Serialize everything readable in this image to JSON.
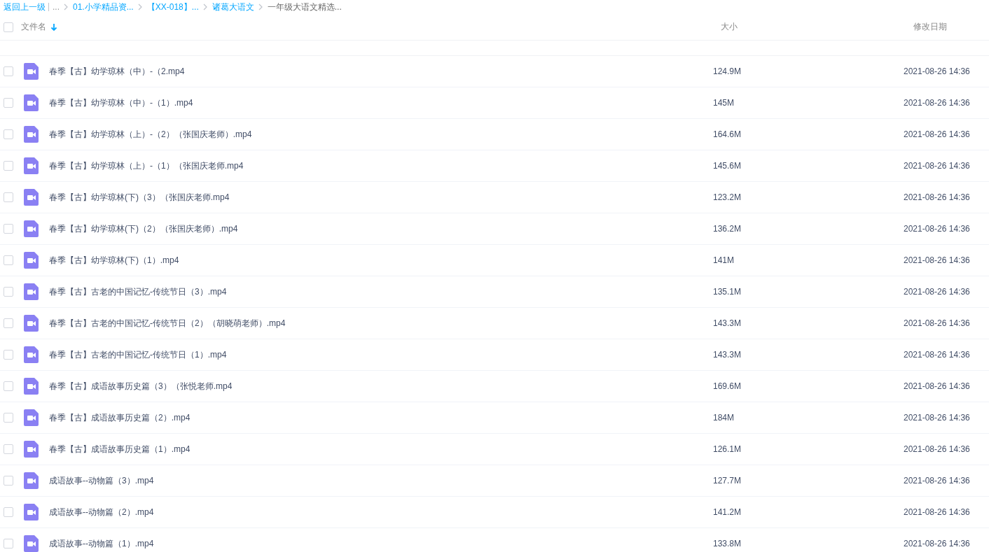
{
  "breadcrumb": {
    "back": "返回上一级",
    "items": [
      {
        "label": "...",
        "kind": "ellipsis"
      },
      {
        "label": "01.小学精品资...",
        "kind": "link"
      },
      {
        "label": "【XX-018】...",
        "kind": "link"
      },
      {
        "label": "诸葛大语文",
        "kind": "link"
      },
      {
        "label": "一年级大语文精选...",
        "kind": "current"
      }
    ]
  },
  "table": {
    "select_all": {
      "checked": false
    },
    "columns": [
      {
        "label": "文件名",
        "sorted": true
      },
      {
        "label": "大小",
        "sorted": false
      },
      {
        "label": "修改日期",
        "sorted": false
      }
    ],
    "rows": [
      {
        "name": "春季【古】幼学琼林（中）-（2.mp4",
        "size": "124.9M",
        "modified": "2021-08-26 14:36",
        "checked": false
      },
      {
        "name": "春季【古】幼学琼林（中）-（1）.mp4",
        "size": "145M",
        "modified": "2021-08-26 14:36",
        "checked": false
      },
      {
        "name": "春季【古】幼学琼林（上）-（2）（张国庆老师）.mp4",
        "size": "164.6M",
        "modified": "2021-08-26 14:36",
        "checked": false
      },
      {
        "name": "春季【古】幼学琼林（上）-（1）（张国庆老师.mp4",
        "size": "145.6M",
        "modified": "2021-08-26 14:36",
        "checked": false
      },
      {
        "name": "春季【古】幼学琼林(下)（3）（张国庆老师.mp4",
        "size": "123.2M",
        "modified": "2021-08-26 14:36",
        "checked": false
      },
      {
        "name": "春季【古】幼学琼林(下)（2）（张国庆老师）.mp4",
        "size": "136.2M",
        "modified": "2021-08-26 14:36",
        "checked": false
      },
      {
        "name": "春季【古】幼学琼林(下)（1）.mp4",
        "size": "141M",
        "modified": "2021-08-26 14:36",
        "checked": false
      },
      {
        "name": "春季【古】古老的中国记忆-传统节日（3）.mp4",
        "size": "135.1M",
        "modified": "2021-08-26 14:36",
        "checked": false
      },
      {
        "name": "春季【古】古老的中国记忆-传统节日（2）（胡晓萌老师）.mp4",
        "size": "143.3M",
        "modified": "2021-08-26 14:36",
        "checked": false
      },
      {
        "name": "春季【古】古老的中国记忆-传统节日（1）.mp4",
        "size": "143.3M",
        "modified": "2021-08-26 14:36",
        "checked": false
      },
      {
        "name": "春季【古】成语故事历史篇（3）（张悦老师.mp4",
        "size": "169.6M",
        "modified": "2021-08-26 14:36",
        "checked": false
      },
      {
        "name": "春季【古】成语故事历史篇（2）.mp4",
        "size": "184M",
        "modified": "2021-08-26 14:36",
        "checked": false
      },
      {
        "name": "春季【古】成语故事历史篇（1）.mp4",
        "size": "126.1M",
        "modified": "2021-08-26 14:36",
        "checked": false
      },
      {
        "name": "成语故事--动物篇（3）.mp4",
        "size": "127.7M",
        "modified": "2021-08-26 14:36",
        "checked": false
      },
      {
        "name": "成语故事--动物篇（2）.mp4",
        "size": "141.2M",
        "modified": "2021-08-26 14:36",
        "checked": false
      },
      {
        "name": "成语故事--动物篇（1）.mp4",
        "size": "133.8M",
        "modified": "2021-08-26 14:36",
        "checked": false
      }
    ]
  }
}
